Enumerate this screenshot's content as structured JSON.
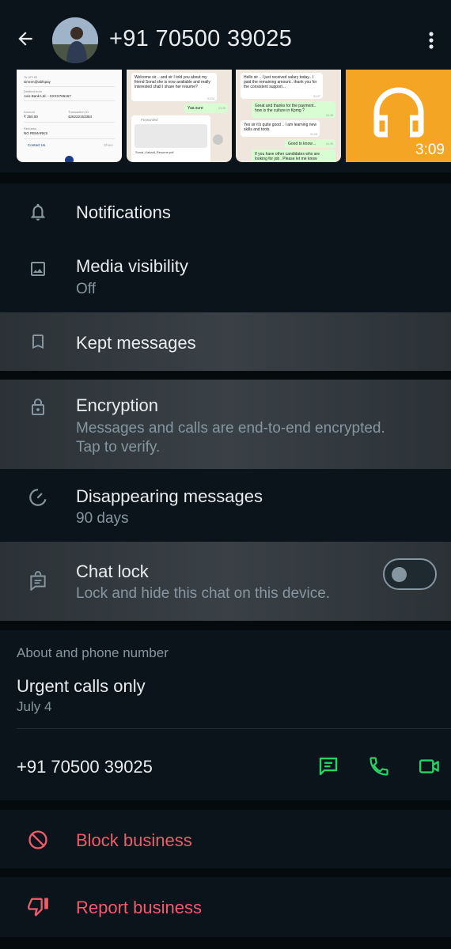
{
  "header": {
    "title": "+91 70500 39025",
    "back_icon": "arrow-back-icon",
    "more_icon": "more-vert-icon"
  },
  "media": {
    "thumb1": {
      "lines": [
        "To UPI ID",
        "simren@abfspay",
        "Debited from",
        "Axis Bank Ltd. - XXXX766167",
        "Amount",
        "₹ 350.00",
        "Transaction ID",
        "426222153384",
        "Remarks",
        "NO REMARKS",
        "Contact Us",
        "Share"
      ]
    },
    "thumb2": {
      "msg1": "Welcome sir .. and sir I told you about my friend Sonal she is now available and really interested shall I share her resume?",
      "msg1_time": "01:24",
      "msg2": "Yaa sure",
      "msg2_time": "01:25",
      "forwarded": "Forwarded",
      "doc_name": "Sonal_Kakadi_Resume.pdf"
    },
    "thumb3": {
      "msg1": "Hello sir .. I just received salary today.. I paid the remaining amount.. thank you for the consistent support ..",
      "msg1_time": "01:27",
      "msg2": "Great and thanks for the payment.. how is the culture in Kpmg ?",
      "msg2_time": "01:28",
      "msg3": "Yes sir it's quite good .. I am learning new skills and tools",
      "msg3_time": "01:28",
      "msg4": "Good to know ..",
      "msg4_time": "01:29",
      "msg5": "If you have other candidates who are looking for job . Please let me know"
    },
    "thumb4": {
      "duration": "3:09",
      "icon": "headphones-icon"
    }
  },
  "settings": [
    {
      "key": "notifications",
      "label": "Notifications",
      "icon": "bell-icon"
    },
    {
      "key": "media_visibility",
      "label": "Media visibility",
      "sub": "Off",
      "icon": "image-icon"
    },
    {
      "key": "kept_messages",
      "label": "Kept messages",
      "icon": "bookmark-icon"
    },
    {
      "key": "encryption",
      "label": "Encryption",
      "sub": "Messages and calls are end-to-end encrypted.",
      "sub2": "Tap to verify.",
      "icon": "lock-icon"
    },
    {
      "key": "disappearing",
      "label": "Disappearing messages",
      "sub": "90 days",
      "icon": "timer-icon"
    },
    {
      "key": "chat_lock",
      "label": "Chat lock",
      "sub": "Lock and hide this chat on this device.",
      "icon": "chat-lock-icon",
      "toggle_on": false
    }
  ],
  "about": {
    "section_title": "About and phone number",
    "status": "Urgent calls only",
    "date": "July 4",
    "phone": "+91 70500 39025",
    "actions": [
      "message-icon",
      "phone-icon",
      "video-icon"
    ]
  },
  "actions": {
    "block": "Block business",
    "report": "Report business"
  },
  "colors": {
    "background": "#0b141a",
    "accent": "#25d366",
    "danger": "#f15c6d",
    "secondary_text": "#8696a0"
  }
}
